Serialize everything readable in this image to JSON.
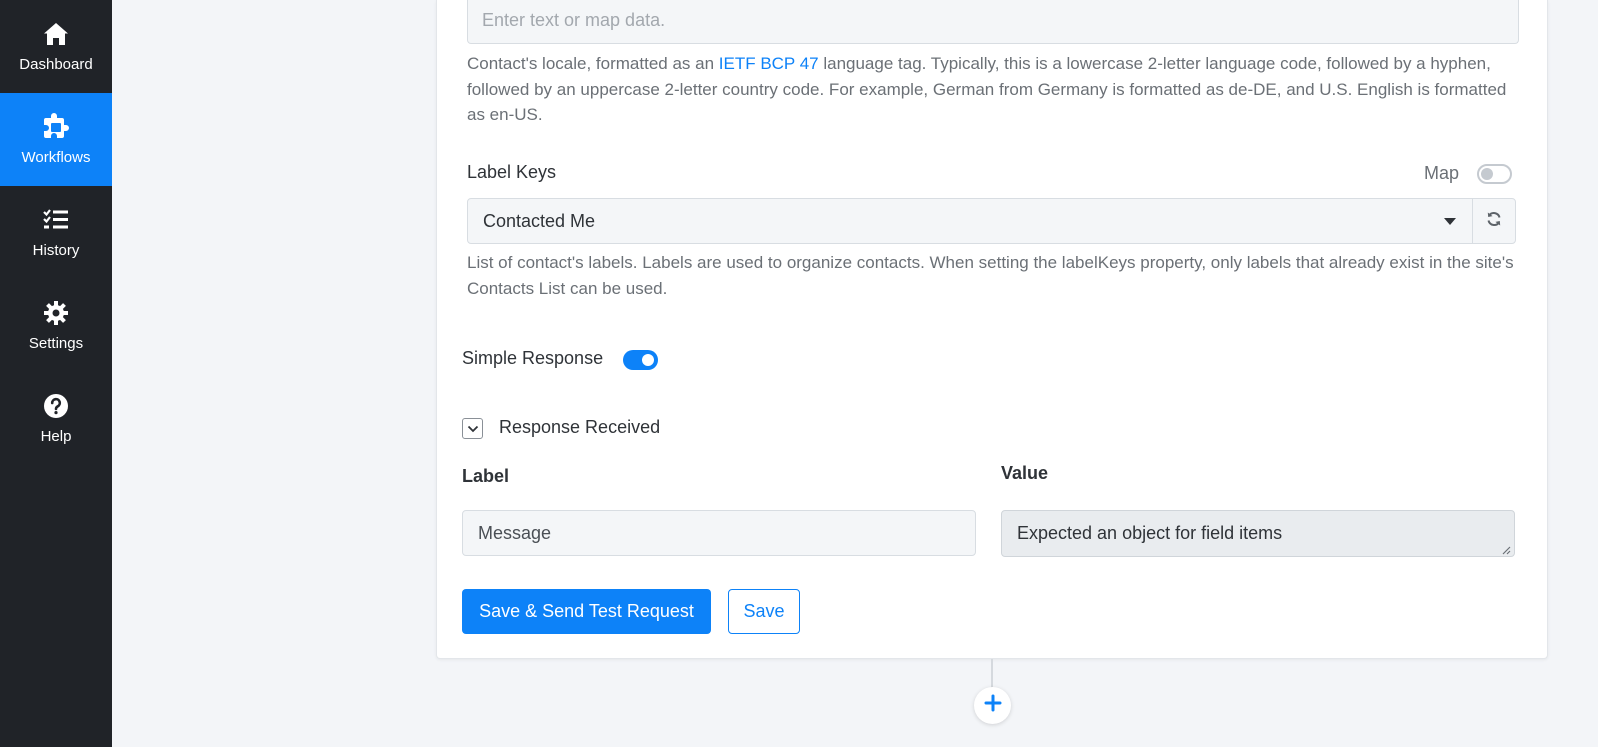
{
  "sidebar": {
    "items": [
      {
        "label": "Dashboard",
        "icon": "home-icon",
        "active": false
      },
      {
        "label": "Workflows",
        "icon": "puzzle-icon",
        "active": true
      },
      {
        "label": "History",
        "icon": "checklist-icon",
        "active": false
      },
      {
        "label": "Settings",
        "icon": "gear-icon",
        "active": false
      },
      {
        "label": "Help",
        "icon": "question-circle-icon",
        "active": false
      }
    ]
  },
  "locale_field": {
    "placeholder": "Enter text or map data.",
    "help_before": "Contact's locale, formatted as an ",
    "help_link": "IETF BCP 47",
    "help_after": " language tag. Typically, this is a lowercase 2-letter language code, followed by a hyphen, followed by an uppercase 2-letter country code. For example, German from Germany is formatted as de-DE, and U.S. English is formatted as en-US."
  },
  "label_keys_field": {
    "label": "Label Keys",
    "map_label": "Map",
    "selected_value": "Contacted Me",
    "help": "List of contact's labels. Labels are used to organize contacts. When setting the labelKeys property, only labels that already exist in the site's Contacts List can be used."
  },
  "simple_response": {
    "label": "Simple Response",
    "enabled": true
  },
  "response_received": {
    "title": "Response Received",
    "label_header": "Label",
    "value_header": "Value",
    "label_value": "Message",
    "value_value": "Expected an object for field items"
  },
  "actions": {
    "primary": "Save & Send Test Request",
    "secondary": "Save"
  },
  "colors": {
    "accent": "#0d82f8",
    "sidebar_bg": "#202328"
  }
}
